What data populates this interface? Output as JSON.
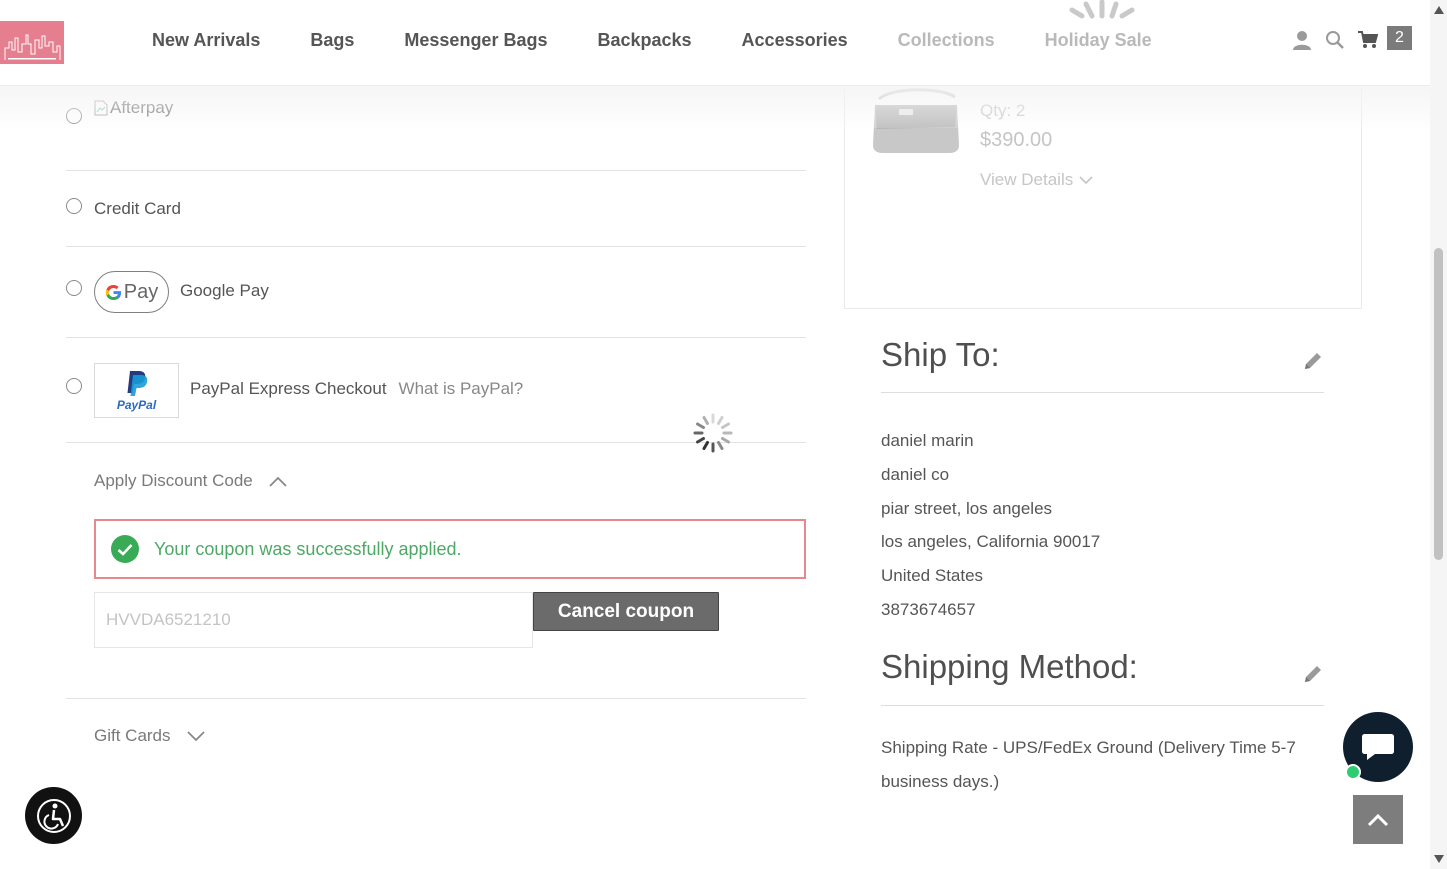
{
  "nav": {
    "items": [
      "New Arrivals",
      "Bags",
      "Messenger Bags",
      "Backpacks",
      "Accessories",
      "Collections",
      "Holiday Sale"
    ],
    "cart_count": "2"
  },
  "payment": {
    "afterpay_alt": "Afterpay",
    "credit_card": "Credit Card",
    "google_pay_badge": "Pay",
    "google_pay": "Google Pay",
    "paypal_logo_text": "PayPal",
    "paypal": "PayPal Express Checkout",
    "paypal_help": "What is PayPal?"
  },
  "discount": {
    "toggle": "Apply Discount Code",
    "success": "Your coupon was successfully applied.",
    "code": "HVVDA6521210",
    "cancel": "Cancel coupon"
  },
  "gift_cards": "Gift Cards",
  "cart": {
    "qty": "Qty: 2",
    "price": "$390.00",
    "view_details": "View Details"
  },
  "ship_to": {
    "title": "Ship To:",
    "lines": [
      "daniel marin",
      "daniel co",
      "piar street, los angeles",
      "los angeles, California 90017",
      "United States",
      "3873674657"
    ]
  },
  "shipping_method": {
    "title": "Shipping Method:",
    "text": "Shipping Rate - UPS/FedEx Ground (Delivery Time 5-7 business days.)"
  },
  "colors": {
    "success": "#39ab57",
    "error_border": "#e5898f",
    "logo_bg": "#e57e8e",
    "chat_bg": "#0f1f2e"
  }
}
